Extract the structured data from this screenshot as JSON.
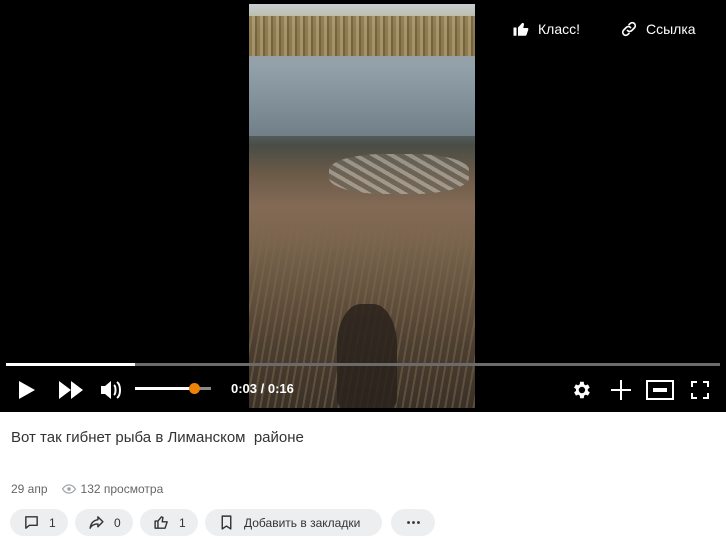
{
  "player": {
    "like_label": "Класс!",
    "link_label": "Ссылка",
    "time": "0:03 / 0:16",
    "progress_fraction": 0.18,
    "volume_fraction": 0.78
  },
  "video": {
    "title": "Вот так гибнет рыба в Лиманском  районе",
    "date": "29 апр",
    "views": "132 просмотра"
  },
  "actions": {
    "comments_count": "1",
    "shares_count": "0",
    "likes_count": "1",
    "bookmark_label": "Добавить в закладки"
  },
  "colors": {
    "accent": "#ee8208",
    "pill_bg": "#eceef0"
  },
  "icons": [
    "thumbs-up-icon",
    "link-icon",
    "play-icon",
    "forward-icon",
    "volume-icon",
    "settings-icon",
    "plus-icon",
    "miniplayer-icon",
    "fullscreen-icon",
    "eye-icon",
    "comment-icon",
    "share-icon",
    "like-icon",
    "bookmark-icon",
    "more-icon"
  ]
}
